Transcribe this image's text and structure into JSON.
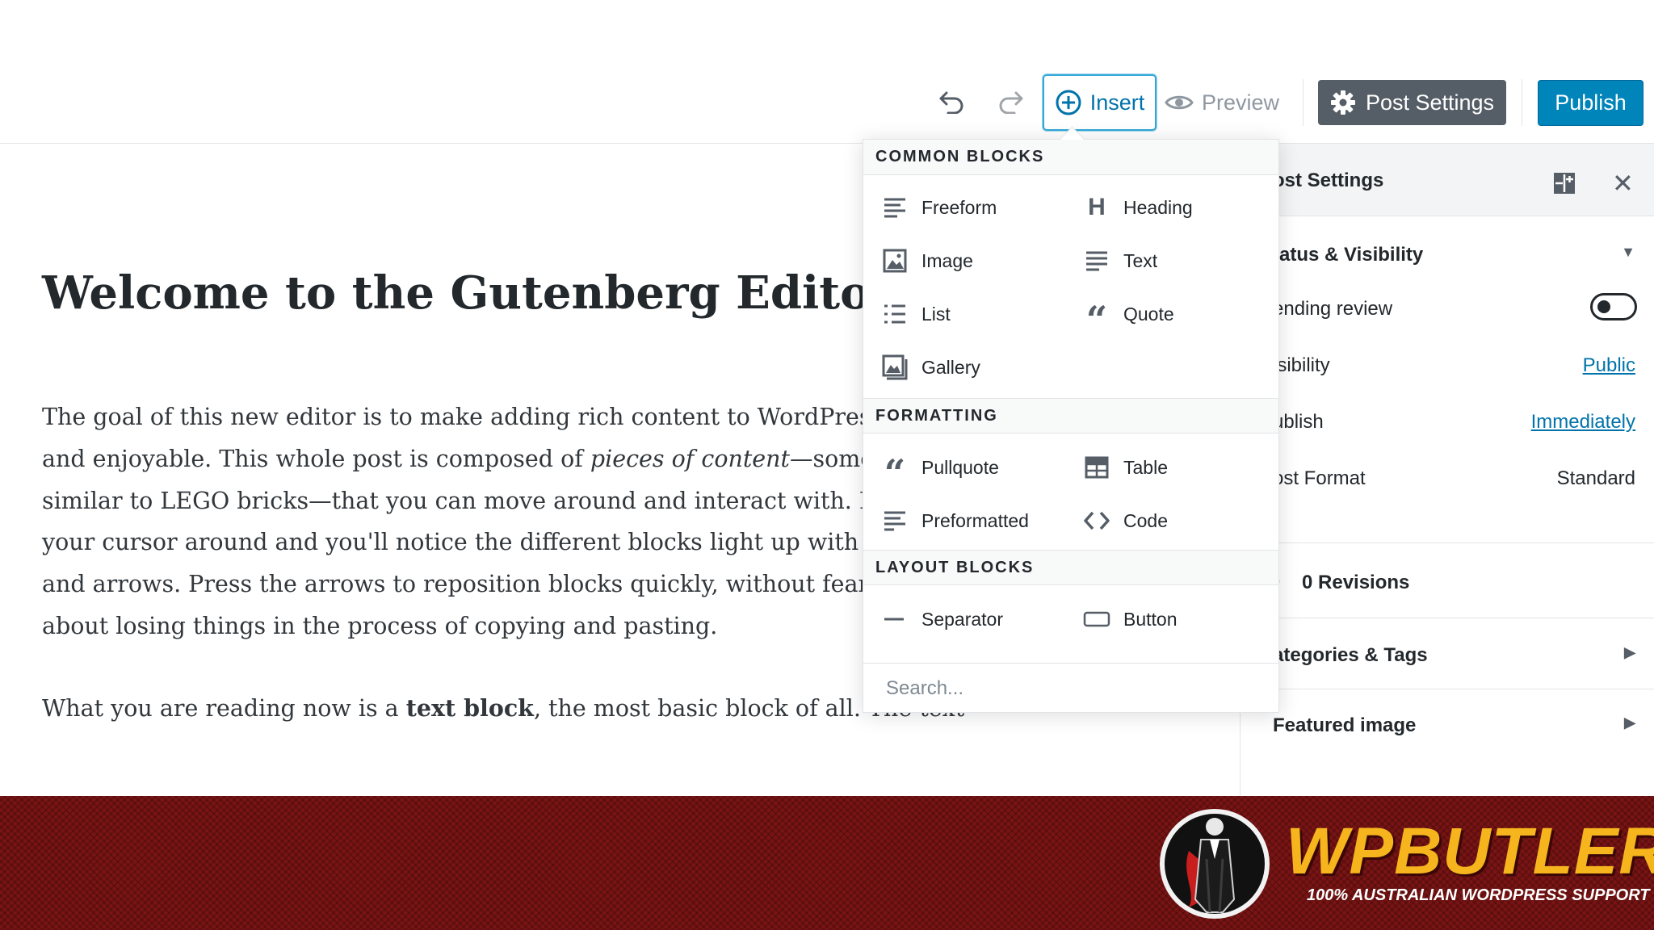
{
  "toolbar": {
    "insert_label": "Insert",
    "preview_label": "Preview",
    "post_settings_label": "Post Settings",
    "publish_label": "Publish"
  },
  "editor": {
    "title": "Welcome to the Gutenberg Editor",
    "paragraph1_lines": [
      [
        "The goal of this new editor is to make adding rich content to WordPress s"
      ],
      [
        "and enjoyable. This whole post is composed of ",
        "pieces of content",
        "—somew"
      ],
      [
        "similar to LEGO bricks—that you can move around and interact with. Mo"
      ],
      [
        "your cursor around and you'll notice the different blocks light up with o"
      ],
      [
        "and arrows. Press the arrows to reposition blocks quickly, without feari"
      ],
      [
        "about losing things in the process of copying and pasting."
      ]
    ],
    "paragraph2": {
      "before": "What you are reading now is a ",
      "bold": "text block",
      "after": ", the most basic block of all. The text"
    }
  },
  "sidebar": {
    "title": "ost Settings",
    "status_heading": "tatus & Visibility",
    "pending_label": "ending review",
    "visibility_label": "isibility",
    "visibility_value": "Public",
    "publish_label": "ublish",
    "publish_value": "Immediately",
    "format_label": "ost Format",
    "format_value": "Standard",
    "revisions_label": "0 Revisions",
    "categories_label": "ategories & Tags",
    "featured_label": "Featured image"
  },
  "inserter": {
    "categories": [
      {
        "name": "COMMON BLOCKS",
        "blocks": [
          {
            "label": "Freeform",
            "icon": "freeform-icon"
          },
          {
            "label": "Heading",
            "icon": "heading-icon"
          },
          {
            "label": "Image",
            "icon": "image-icon"
          },
          {
            "label": "Text",
            "icon": "text-icon"
          },
          {
            "label": "List",
            "icon": "list-icon"
          },
          {
            "label": "Quote",
            "icon": "quote-icon"
          },
          {
            "label": "Gallery",
            "icon": "gallery-icon"
          }
        ]
      },
      {
        "name": "FORMATTING",
        "blocks": [
          {
            "label": "Pullquote",
            "icon": "pullquote-icon"
          },
          {
            "label": "Table",
            "icon": "table-icon"
          },
          {
            "label": "Preformatted",
            "icon": "preformatted-icon"
          },
          {
            "label": "Code",
            "icon": "code-icon"
          }
        ]
      },
      {
        "name": "LAYOUT BLOCKS",
        "blocks": [
          {
            "label": "Separator",
            "icon": "separator-icon"
          },
          {
            "label": "Button",
            "icon": "button-icon"
          }
        ]
      }
    ],
    "search_placeholder": "Search..."
  },
  "banner": {
    "brand": "WPBUTLER",
    "tagline": "100% AUSTRALIAN WORDPRESS SUPPORT"
  },
  "colors": {
    "accent": "#0085ba",
    "link": "#0073aa",
    "dark_button": "#555d66",
    "banner_red": "#7a1414",
    "brand_yellow": "#f6b51d"
  }
}
